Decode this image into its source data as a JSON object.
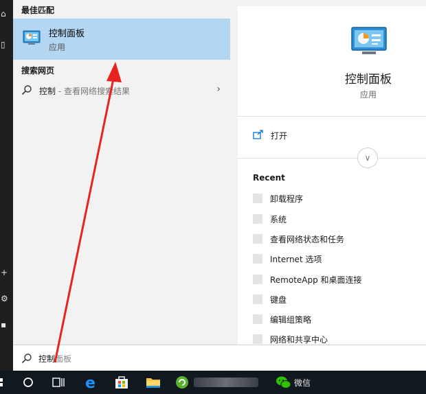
{
  "search_results": {
    "best_match_heading": "最佳匹配",
    "best_match": {
      "title": "控制面板",
      "subtitle": "应用"
    },
    "web_heading": "搜索网页",
    "web_result": {
      "query": "控制",
      "suffix": " - 查看网络搜索结果"
    }
  },
  "details": {
    "title": "控制面板",
    "subtitle": "应用",
    "open_label": "打开",
    "recent_heading": "Recent",
    "recent_items": [
      "卸载程序",
      "系统",
      "查看网络状态和任务",
      "Internet 选项",
      "RemoteApp 和桌面连接",
      "键盘",
      "编辑组策略",
      "网络和共享中心"
    ]
  },
  "search_box": {
    "typed": "控制",
    "suggestion": "面板"
  },
  "taskbar": {
    "wechat_label": "微信"
  },
  "colors": {
    "selection": "#b3d7f2",
    "accent": "#0078d7",
    "annotation": "#e8231e",
    "taskbar": "#101820"
  }
}
